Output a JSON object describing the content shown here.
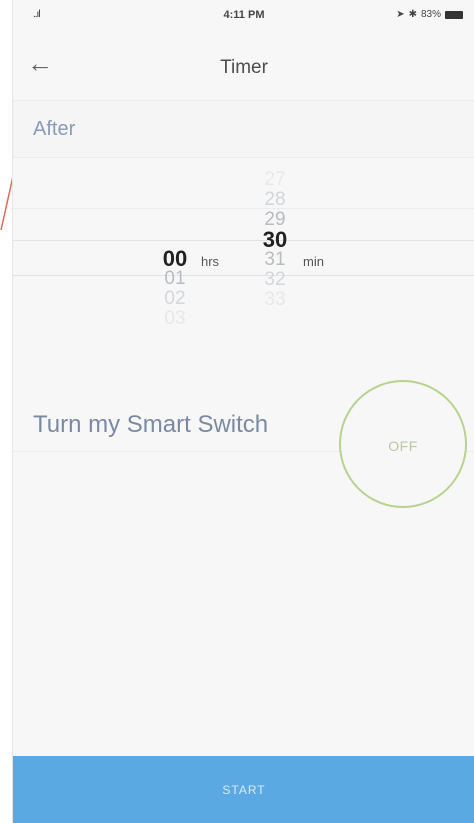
{
  "status_bar": {
    "signal": "..ıl",
    "time": "4:11 PM",
    "battery_text": "83%"
  },
  "header": {
    "back_label": "←",
    "title": "Timer"
  },
  "after": {
    "label": "After"
  },
  "picker": {
    "hours": {
      "above": [],
      "selected": "00",
      "below": [
        "01",
        "02",
        "03"
      ],
      "unit": "hrs"
    },
    "minutes": {
      "above": [
        "27",
        "28",
        "29"
      ],
      "selected": "30",
      "below": [
        "31",
        "32",
        "33"
      ],
      "unit": "min"
    }
  },
  "switch_row": {
    "label": "Turn my Smart Switch",
    "toggle_state": "OFF"
  },
  "start_button": {
    "label": "START"
  },
  "colors": {
    "accent": "#5aa9e3",
    "toggle_border": "#b7d28e",
    "annotation": "#e06b55"
  }
}
